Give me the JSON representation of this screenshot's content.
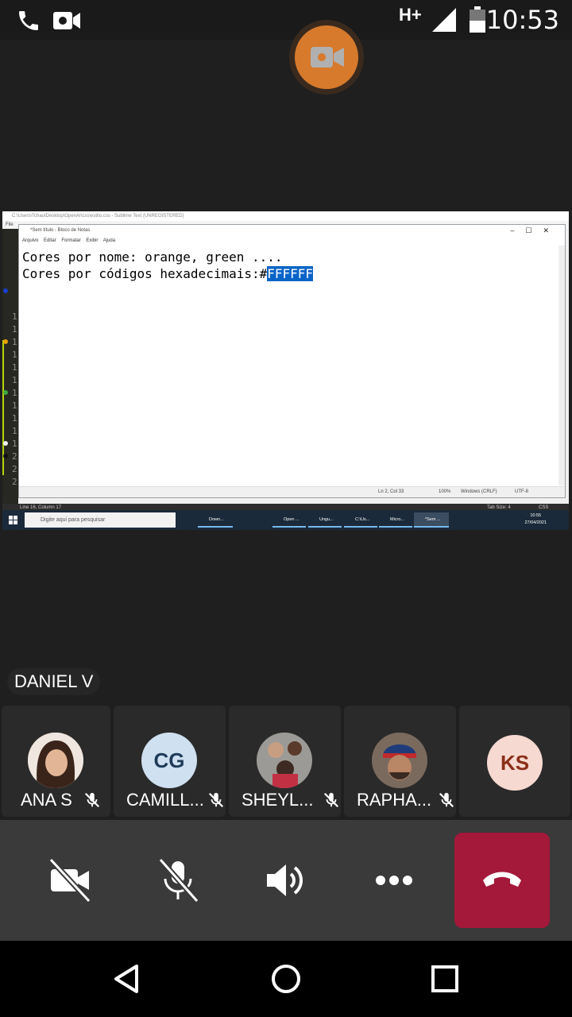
{
  "status_bar": {
    "time": "10:53",
    "network": "H+",
    "icons": [
      "phone-icon",
      "video-camera-icon",
      "signal-icon",
      "battery-icon"
    ]
  },
  "presenter": {
    "icon": "video-camera-icon",
    "color": "#d77a2c"
  },
  "shared_screen": {
    "sublime": {
      "title": "C:\\Users\\Tchau\\Desktop\\OpenAI\\css\\estilo.css - Sublime Text (UNREGISTERED)",
      "menu": "File",
      "line_numbers": [
        "1",
        "1",
        "1",
        "1",
        "1",
        "1",
        "1",
        "1",
        "1",
        "1",
        "1",
        "2",
        "2",
        "2"
      ],
      "status_left": "Line 16, Column 17",
      "status_tab": "Tab Size: 4",
      "status_syntax": "CSS"
    },
    "notepad": {
      "title": "*Sem título - Bloco de Notas",
      "menu": [
        "Arquivo",
        "Editar",
        "Formatar",
        "Exibir",
        "Ajuda"
      ],
      "line1": "Cores por nome: orange, green ....",
      "line2_prefix": "Cores por códigos hexadecimais:#",
      "selected_text": "FFFFFF",
      "status_pos": "Ln 2, Col 33",
      "status_zoom": "100%",
      "status_eol": "Windows (CRLF)",
      "status_enc": "UTF-8"
    },
    "taskbar": {
      "search_placeholder": "Digite aqui para pesquisar",
      "apps": [
        "Down...",
        "Open ...",
        "Ungu...",
        "C:\\Us...",
        "Micro...",
        "*Sem ..."
      ],
      "clock_time": "10:55",
      "clock_date": "27/04/2021"
    }
  },
  "speaker": {
    "name": "DANIEL V"
  },
  "participants": [
    {
      "name": "ANA S",
      "initials": "",
      "muted": true
    },
    {
      "name": "CAMILL...",
      "initials": "CG",
      "muted": true,
      "color": "#cfe0f0",
      "text_color": "#1f3b5a"
    },
    {
      "name": "SHEYL...",
      "initials": "",
      "muted": true
    },
    {
      "name": "RAPHA...",
      "initials": "",
      "muted": true
    },
    {
      "name": "",
      "initials": "KS",
      "muted": false,
      "color": "#f6d9d0",
      "text_color": "#8a2f1a"
    }
  ],
  "controls": {
    "buttons": [
      "camera-off-icon",
      "mic-off-icon",
      "speaker-icon",
      "more-icon",
      "end-call-icon"
    ],
    "end_call_color": "#a4183a"
  },
  "nav": {
    "icons": [
      "back-icon",
      "home-icon",
      "recents-icon"
    ]
  }
}
